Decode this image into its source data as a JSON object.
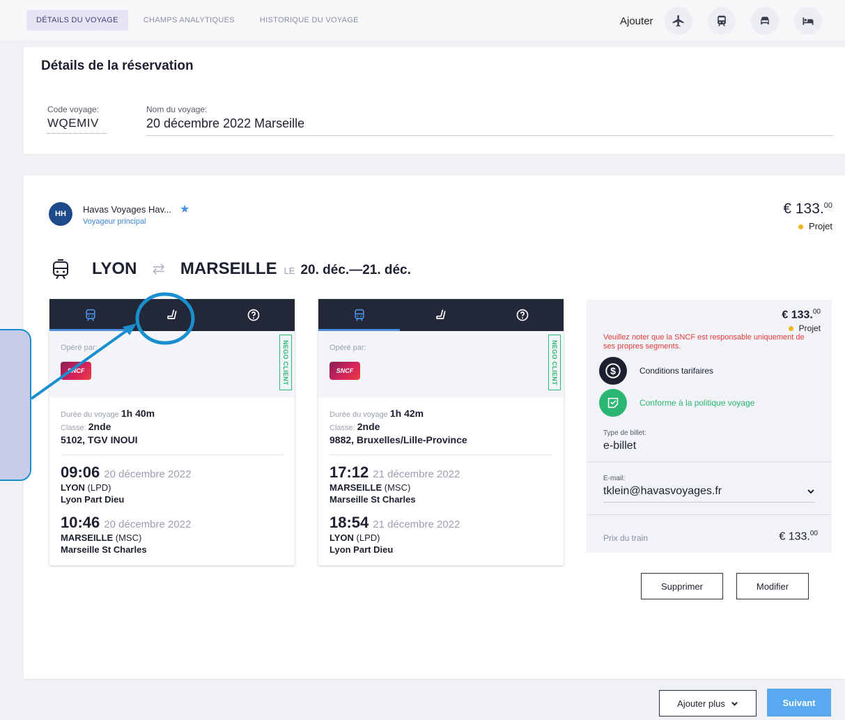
{
  "tabs": [
    {
      "label": "DÉTAILS DU VOYAGE",
      "active": true
    },
    {
      "label": "CHAMPS ANALYTIQUES",
      "active": false
    },
    {
      "label": "HISTORIQUE DU VOYAGE",
      "active": false
    }
  ],
  "add": {
    "label": "Ajouter",
    "icons": [
      "plane-icon",
      "train-icon",
      "car-icon",
      "hotel-icon"
    ]
  },
  "reservation": {
    "title": "Détails de la réservation",
    "code_label": "Code voyage:",
    "code_value": "WQEMIV",
    "name_label": "Nom du voyage:",
    "name_value": "20 décembre 2022 Marseille"
  },
  "traveler": {
    "initials": "HH",
    "name": "Havas Voyages Hav...",
    "role": "Voyageur principal"
  },
  "trip_price": {
    "currency": "€",
    "amount": "133.",
    "cents": "00",
    "status": "Projet"
  },
  "route": {
    "from": "LYON",
    "to": "MARSEILLE",
    "le": "LE",
    "dates": "20. déc.—21. déc."
  },
  "segments": [
    {
      "operated_by": "Opéré par:",
      "operator": "SNCF",
      "badge": "NEGO CLIENT",
      "duration_label": "Durée du voyage",
      "duration": "1h 40m",
      "class_label": "Classe:",
      "class": "2nde",
      "train": "5102, TGV INOUI",
      "dep_time": "09:06",
      "dep_date": "20 décembre 2022",
      "dep_city": "LYON",
      "dep_code": "(LPD)",
      "dep_station": "Lyon Part Dieu",
      "arr_time": "10:46",
      "arr_date": "20 décembre 2022",
      "arr_city": "MARSEILLE",
      "arr_code": "(MSC)",
      "arr_station": "Marseille St Charles"
    },
    {
      "operated_by": "Opéré par:",
      "operator": "SNCF",
      "badge": "NEGO CLIENT",
      "duration_label": "Durée du voyage",
      "duration": "1h 42m",
      "class_label": "Classe:",
      "class": "2nde",
      "train": "9882, Bruxelles/Lille-Province",
      "dep_time": "17:12",
      "dep_date": "21 décembre 2022",
      "dep_city": "MARSEILLE",
      "dep_code": "(MSC)",
      "dep_station": "Marseille St Charles",
      "arr_time": "18:54",
      "arr_date": "21 décembre 2022",
      "arr_city": "LYON",
      "arr_code": "(LPD)",
      "arr_station": "Lyon Part Dieu"
    }
  ],
  "panel": {
    "currency": "€",
    "amount": "133.",
    "cents": "00",
    "status": "Projet",
    "warning": "Veuillez noter que la SNCF est responsable uniquement de ses propres segments.",
    "fare_conditions": "Conditions tarifaires",
    "policy": "Conforme à la politique voyage",
    "ticket_type_label": "Type de billet:",
    "ticket_type": "e-billet",
    "email_label": "E-mail:",
    "email": "tklein@havasvoyages.fr",
    "train_price_label": "Prix du train",
    "train_price_currency": "€",
    "train_price_amount": "133.",
    "train_price_cents": "00"
  },
  "buttons": {
    "delete": "Supprimer",
    "edit": "Modifier",
    "add_more": "Ajouter plus",
    "next": "Suivant"
  },
  "colors": {
    "nav_dark": "#232838",
    "accent_blue": "#4a8fe0",
    "next_blue": "#58a9ef",
    "warning_red": "#e23b3b",
    "policy_green": "#2bb673",
    "status_yellow": "#f1b61d"
  }
}
